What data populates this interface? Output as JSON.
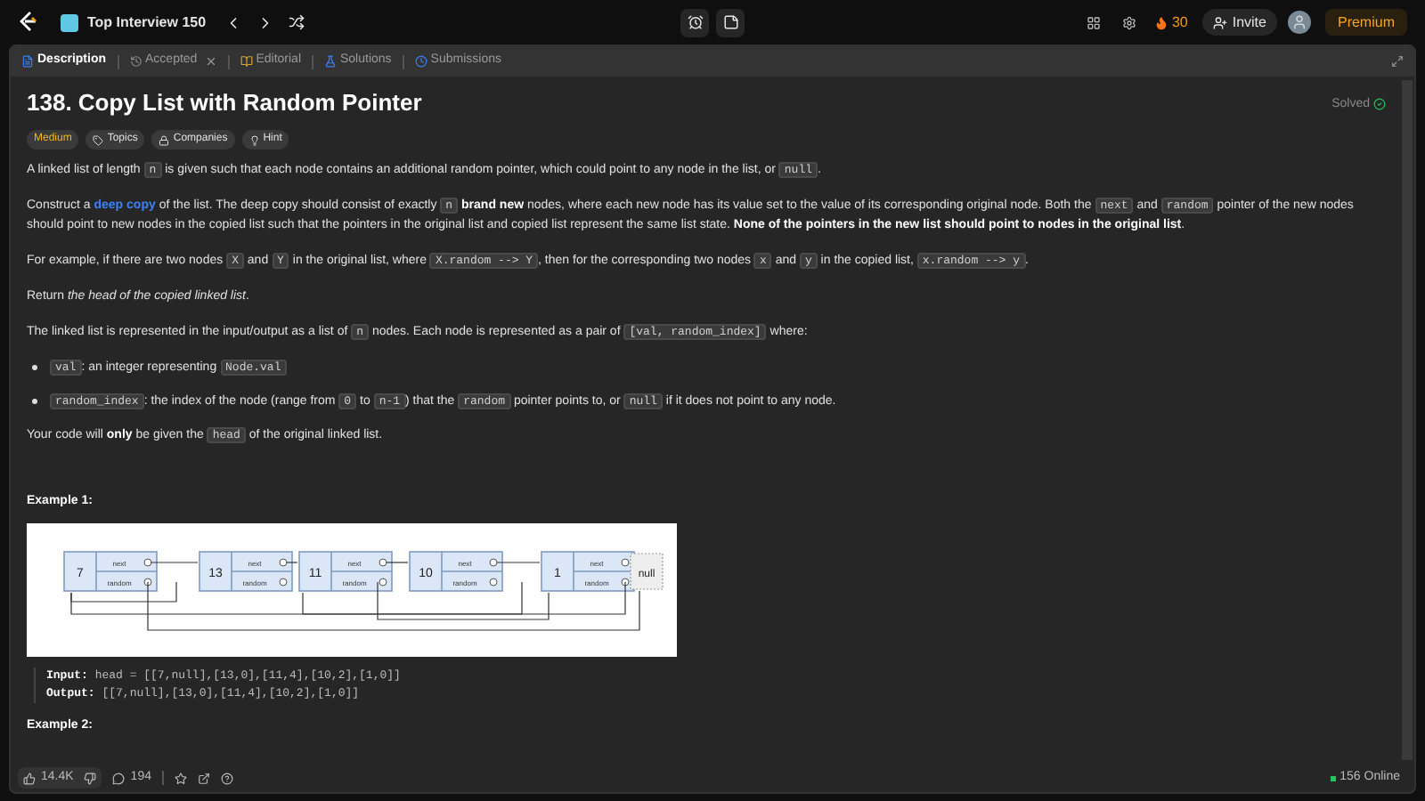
{
  "top_bar": {
    "list_title": "Top Interview 150",
    "streak": "30",
    "invite": "Invite",
    "premium": "Premium"
  },
  "tabs": [
    {
      "label": "Description",
      "selected": true,
      "closable": false
    },
    {
      "label": "Accepted",
      "selected": false,
      "closable": true
    },
    {
      "label": "Editorial",
      "selected": false,
      "closable": false
    },
    {
      "label": "Solutions",
      "selected": false,
      "closable": false
    },
    {
      "label": "Submissions",
      "selected": false,
      "closable": false
    }
  ],
  "problem": {
    "title": "138. Copy List with Random Pointer",
    "status": "Solved",
    "difficulty": "Medium",
    "chips": [
      "Topics",
      "Companies",
      "Hint"
    ]
  },
  "paragraphs": [
    {
      "kind": "para",
      "segments": [
        {
          "kind": "text",
          "text": "A linked list of length "
        },
        {
          "kind": "code",
          "text": "n"
        },
        {
          "kind": "text",
          "text": " is given such that each node contains an additional random pointer, which could point to any node in the list, or "
        },
        {
          "kind": "code",
          "text": "null"
        },
        {
          "kind": "text",
          "text": "."
        }
      ]
    },
    {
      "kind": "para",
      "segments": [
        {
          "kind": "text",
          "text": "Construct a "
        },
        {
          "kind": "link",
          "text": "deep copy"
        },
        {
          "kind": "text",
          "text": " of the list. The deep copy should consist of exactly "
        },
        {
          "kind": "code",
          "text": "n"
        },
        {
          "kind": "bold",
          "text": " brand new"
        },
        {
          "kind": "text",
          "text": " nodes, where each new node has its value set to the value of its corresponding original node. Both the "
        },
        {
          "kind": "code",
          "text": "next"
        },
        {
          "kind": "text",
          "text": " and "
        },
        {
          "kind": "code",
          "text": "random"
        },
        {
          "kind": "text",
          "text": " pointer of the new nodes should point to new nodes in the copied list such that the pointers in the original list and copied list represent the same list state. "
        },
        {
          "kind": "bold",
          "text": "None of the pointers in the new list should point to nodes in the original list"
        },
        {
          "kind": "text",
          "text": "."
        }
      ]
    },
    {
      "kind": "para",
      "segments": [
        {
          "kind": "text",
          "text": "For example, if there are two nodes "
        },
        {
          "kind": "code",
          "text": "X"
        },
        {
          "kind": "text",
          "text": " and "
        },
        {
          "kind": "code",
          "text": "Y"
        },
        {
          "kind": "text",
          "text": " in the original list, where "
        },
        {
          "kind": "code",
          "text": "X.random --> Y"
        },
        {
          "kind": "text",
          "text": ", then for the corresponding two nodes "
        },
        {
          "kind": "code",
          "text": "x"
        },
        {
          "kind": "text",
          "text": " and "
        },
        {
          "kind": "code",
          "text": "y"
        },
        {
          "kind": "text",
          "text": " in the copied list, "
        },
        {
          "kind": "code",
          "text": "x.random --> y"
        },
        {
          "kind": "text",
          "text": "."
        }
      ]
    },
    {
      "kind": "para",
      "segments": [
        {
          "kind": "text",
          "text": "Return "
        },
        {
          "kind": "italic",
          "text": "the head of the copied linked list"
        },
        {
          "kind": "text",
          "text": "."
        }
      ]
    },
    {
      "kind": "para",
      "segments": [
        {
          "kind": "text",
          "text": "The linked list is represented in the input/output as a list of "
        },
        {
          "kind": "code",
          "text": "n"
        },
        {
          "kind": "text",
          "text": " nodes. Each node is represented as a pair of "
        },
        {
          "kind": "code",
          "text": "[val, random_index]"
        },
        {
          "kind": "text",
          "text": " where:"
        }
      ]
    },
    {
      "kind": "bullet",
      "segments": [
        {
          "kind": "code",
          "text": "val"
        },
        {
          "kind": "text",
          "text": ": an integer representing "
        },
        {
          "kind": "code",
          "text": "Node.val"
        }
      ]
    },
    {
      "kind": "bullet",
      "segments": [
        {
          "kind": "code",
          "text": "random_index"
        },
        {
          "kind": "text",
          "text": ": the index of the node (range from "
        },
        {
          "kind": "code",
          "text": "0"
        },
        {
          "kind": "text",
          "text": " to "
        },
        {
          "kind": "code",
          "text": "n-1"
        },
        {
          "kind": "text",
          "text": ") that the "
        },
        {
          "kind": "code",
          "text": "random"
        },
        {
          "kind": "text",
          "text": " pointer points to, or "
        },
        {
          "kind": "code",
          "text": "null"
        },
        {
          "kind": "text",
          "text": " if it does not point to any node."
        }
      ]
    },
    {
      "kind": "para",
      "segments": [
        {
          "kind": "text",
          "text": "Your code will "
        },
        {
          "kind": "bold",
          "text": "only"
        },
        {
          "kind": "text",
          "text": " be given the "
        },
        {
          "kind": "code",
          "text": "head"
        },
        {
          "kind": "text",
          "text": " of the original linked list."
        }
      ]
    }
  ],
  "example": {
    "heading": "Example 1:",
    "diagram": {
      "nodes": [
        {
          "value": "7",
          "next_label": "next",
          "random_label": "random"
        },
        {
          "value": "13",
          "next_label": "next",
          "random_label": "random"
        },
        {
          "value": "11",
          "next_label": "next",
          "random_label": "random"
        },
        {
          "value": "10",
          "next_label": "next",
          "random_label": "random"
        },
        {
          "value": "1",
          "next_label": "next",
          "random_label": "random"
        }
      ],
      "null_label": "null"
    },
    "input_label": "Input:",
    "input": "head = [[7,null],[13,0],[11,4],[10,2],[1,0]]",
    "output_label": "Output:",
    "output": "[[7,null],[13,0],[11,4],[10,2],[1,0]]"
  },
  "next_heading": "Example 2:",
  "footer": {
    "likes": "14.4K",
    "comments": "194",
    "online": "156 Online"
  }
}
